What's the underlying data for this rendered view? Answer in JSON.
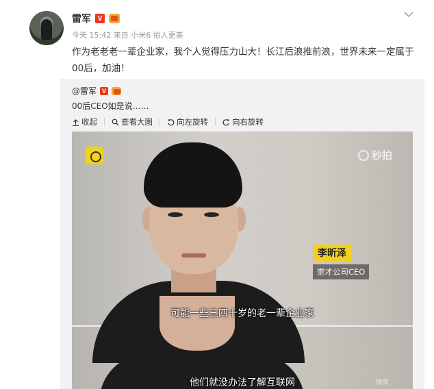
{
  "post": {
    "username": "雷军",
    "v_badge": "V",
    "meta": "今天 15:42 来自 小米6 拍人更美",
    "text": "作为老老老一辈企业家，我个人觉得压力山大！长江后浪推前浪，世界未来一定属于00后，加油！"
  },
  "repost": {
    "username": "@雷军",
    "v_badge": "V",
    "text": "00后CEO如是说……",
    "tools": {
      "collapse": "收起",
      "view_large": "查看大图",
      "rotate_left": "向左旋转",
      "rotate_right": "向右旋转"
    }
  },
  "video": {
    "watermark": "秒拍",
    "person_name": "李昕泽",
    "person_title": "崇才公司CEO",
    "subtitle_1": "可能一些三四十岁的老一辈企业家",
    "subtitle_2": "他们就没办法了解互联网",
    "corner_watermark": "微博"
  },
  "icons": {
    "chevron": "chevron-down-icon",
    "collapse": "arrow-up-icon",
    "view_large": "magnifier-icon",
    "rotate_left": "rotate-left-icon",
    "rotate_right": "rotate-right-icon"
  },
  "colors": {
    "v_badge": "#e8391d",
    "nameplate": "#f2cf24",
    "repost_bg": "#f2f2f5"
  }
}
